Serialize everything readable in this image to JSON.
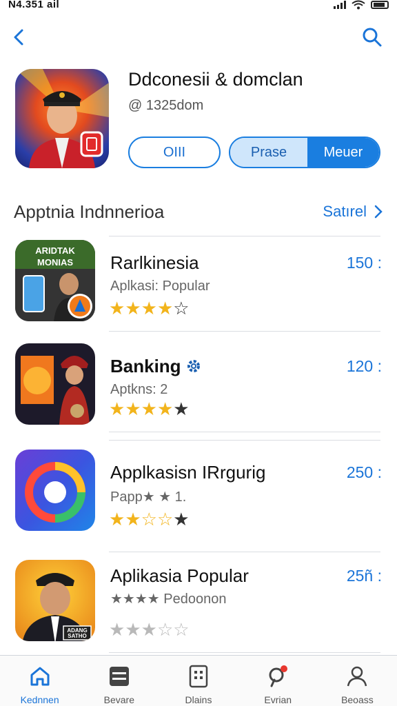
{
  "status_bar": {
    "time": "Ñ4.351 ail"
  },
  "app": {
    "title": "Ddconesii & domclan",
    "subtitle": "@ 1325dom",
    "open_label": "OIII",
    "segment_labels": [
      "Prase",
      "Meuer"
    ]
  },
  "section": {
    "title": "Apptnia Indnnerioa",
    "see_all": "Satırel"
  },
  "icon_labels": {
    "item1": [
      "ARIDTAK",
      "MONIAS"
    ],
    "item4": [
      "ADANG",
      "SATHO"
    ]
  },
  "list": [
    {
      "name": "Rarlkinesia",
      "subtitle": "Aplkasi: Popular",
      "count": "150 :",
      "rating": 4.5
    },
    {
      "name": "Banking",
      "subtitle": "Aptkns: 2",
      "count": "120 :",
      "rating": 4.5
    },
    {
      "name": "Applkasisn IRrgurig",
      "subtitle": "Papp★ ★ 1.",
      "count": "250 :",
      "rating": 3.5
    },
    {
      "name": "Aplikasia Popular",
      "subtitle": "★★★★ Pedoonon",
      "count": "25ñ :",
      "rating": 2.5
    }
  ],
  "tabs": [
    {
      "label": "Kednnen",
      "icon": "home-icon",
      "active": true
    },
    {
      "label": "Bevare",
      "icon": "list-icon",
      "active": false
    },
    {
      "label": "Dlains",
      "icon": "grid-icon",
      "active": false
    },
    {
      "label": "Evrian",
      "icon": "search-icon",
      "active": false
    },
    {
      "label": "Beoass",
      "icon": "person-icon",
      "active": false
    }
  ],
  "colors": {
    "accent": "#1a74d8",
    "star": "#f2b41c"
  }
}
